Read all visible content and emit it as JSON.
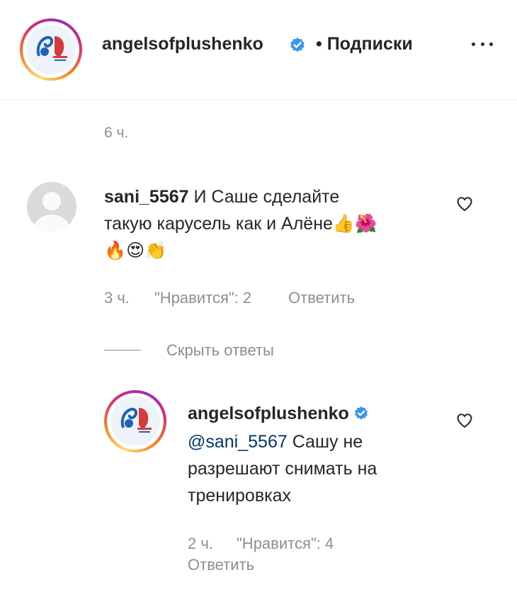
{
  "header": {
    "username": "angelsofplushenko",
    "follow_status": "• Подписки",
    "more_icon": "ellipsis-icon"
  },
  "post": {
    "time": "6 ч."
  },
  "comments": [
    {
      "username": "sani_5567",
      "line1": "И Саше сделайте",
      "line2": "такую карусель как и Алёне",
      "emoji_line2": "👍🌺",
      "line3": "🔥😍👏",
      "time": "3 ч.",
      "likes": "\"Нравится\": 2",
      "reply_label": "Ответить"
    }
  ],
  "hide_replies": "Скрыть ответы",
  "reply": {
    "username": "angelsofplushenko",
    "mention": "@sani_5567",
    "line1_rest": " Сашу не",
    "line2": "разрешают снимать на",
    "line3": "тренировках",
    "time": "2 ч.",
    "likes": "\"Нравится\": 4",
    "reply_label": "Ответить"
  },
  "colors": {
    "verified": "#3897f0",
    "muted": "#8e8e8e",
    "mention": "#00376b"
  }
}
